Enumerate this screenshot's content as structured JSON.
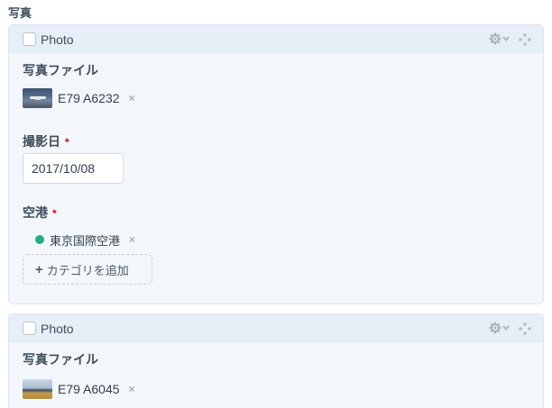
{
  "section": {
    "title": "写真"
  },
  "blocks": [
    {
      "type_label": "Photo",
      "photo_field": {
        "label": "写真ファイル",
        "asset": "E79 A6232",
        "remove": "×"
      },
      "date_field": {
        "label": "撮影日",
        "required": "*",
        "value": "2017/10/08"
      },
      "airport_field": {
        "label": "空港",
        "required": "*",
        "category": "東京国際空港",
        "category_color": "#27ae80",
        "remove": "×",
        "add_button": "カテゴリを追加",
        "add_icon": "+"
      }
    },
    {
      "type_label": "Photo",
      "photo_field": {
        "label": "写真ファイル",
        "asset": "E79 A6045",
        "remove": "×"
      }
    }
  ],
  "icons": {
    "settings": "gear-icon",
    "move": "move-icon"
  }
}
